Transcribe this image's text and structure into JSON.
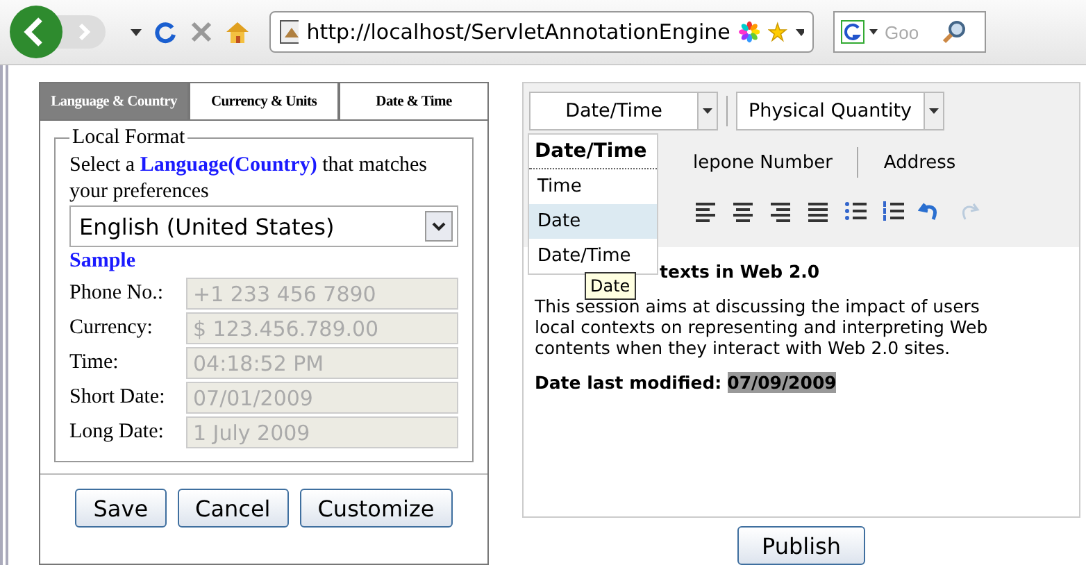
{
  "browser": {
    "url": "http://localhost/ServletAnnotationEngine",
    "search_placeholder": "Goo"
  },
  "left_panel": {
    "tabs": [
      {
        "label": "Language & Country",
        "selected": true
      },
      {
        "label": "Currency & Units",
        "selected": false
      },
      {
        "label": "Date & Time",
        "selected": false
      }
    ],
    "fieldset_title": "Local Format",
    "prompt": "Select a **Language(Country)** that matches your preferences",
    "language_select": "English (United States)",
    "sample_title": "Sample",
    "fields": [
      {
        "label": "Phone No.:",
        "value": "+1 233 456 7890"
      },
      {
        "label": "Currency:",
        "value": "$ 123.456.789.00"
      },
      {
        "label": "Time:",
        "value": "04:18:52 PM"
      },
      {
        "label": "Short Date:",
        "value": "07/01/2009"
      },
      {
        "label": "Long Date:",
        "value": "1 July 2009"
      }
    ],
    "buttons": [
      "Save",
      "Cancel",
      "Customize"
    ]
  },
  "editor": {
    "dropdowns": [
      "Date/Time",
      "Physical Quantity"
    ],
    "annotation_tabs": [
      "lepone Number",
      "Address"
    ],
    "menu": {
      "header": "Date/Time",
      "items": [
        {
          "label": "Time",
          "selected": false
        },
        {
          "label": "Date",
          "selected": true
        },
        {
          "label": "Date/Time",
          "selected": false
        }
      ]
    },
    "tooltip": "Date",
    "heading": "texts in Web 2.0",
    "body": "This session aims at discussing the impact of users local contexts on representing and interpreting Web contents when they interact with Web 2.0 sites.",
    "modified_label": "Date last modified:",
    "modified_value": "07/09/2009",
    "publish": "Publish"
  }
}
